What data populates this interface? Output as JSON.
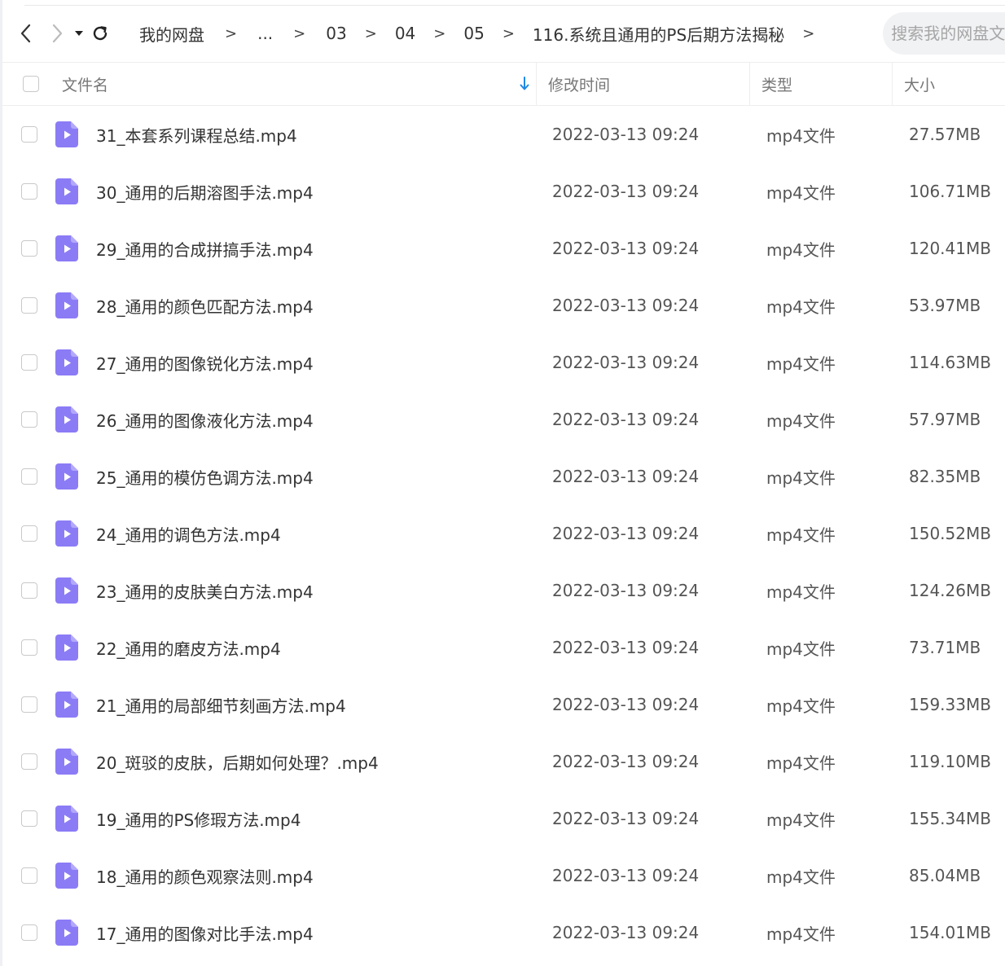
{
  "toolbar": {
    "breadcrumb": [
      "我的网盘",
      "...",
      "03",
      "04",
      "05",
      "116.系统且通用的PS后期方法揭秘"
    ],
    "breadcrumb_sep": ">",
    "search_placeholder": "搜索我的网盘文件"
  },
  "table": {
    "headers": {
      "name": "文件名",
      "time": "修改时间",
      "type": "类型",
      "size": "大小"
    },
    "rows": [
      {
        "name": "31_本套系列课程总结.mp4",
        "time": "2022-03-13 09:24",
        "type": "mp4文件",
        "size": "27.57MB"
      },
      {
        "name": "30_通用的后期溶图手法.mp4",
        "time": "2022-03-13 09:24",
        "type": "mp4文件",
        "size": "106.71MB"
      },
      {
        "name": "29_通用的合成拼搞手法.mp4",
        "time": "2022-03-13 09:24",
        "type": "mp4文件",
        "size": "120.41MB"
      },
      {
        "name": "28_通用的颜色匹配方法.mp4",
        "time": "2022-03-13 09:24",
        "type": "mp4文件",
        "size": "53.97MB"
      },
      {
        "name": "27_通用的图像锐化方法.mp4",
        "time": "2022-03-13 09:24",
        "type": "mp4文件",
        "size": "114.63MB"
      },
      {
        "name": "26_通用的图像液化方法.mp4",
        "time": "2022-03-13 09:24",
        "type": "mp4文件",
        "size": "57.97MB"
      },
      {
        "name": "25_通用的模仿色调方法.mp4",
        "time": "2022-03-13 09:24",
        "type": "mp4文件",
        "size": "82.35MB"
      },
      {
        "name": "24_通用的调色方法.mp4",
        "time": "2022-03-13 09:24",
        "type": "mp4文件",
        "size": "150.52MB"
      },
      {
        "name": "23_通用的皮肤美白方法.mp4",
        "time": "2022-03-13 09:24",
        "type": "mp4文件",
        "size": "124.26MB"
      },
      {
        "name": "22_通用的磨皮方法.mp4",
        "time": "2022-03-13 09:24",
        "type": "mp4文件",
        "size": "73.71MB"
      },
      {
        "name": "21_通用的局部细节刻画方法.mp4",
        "time": "2022-03-13 09:24",
        "type": "mp4文件",
        "size": "159.33MB"
      },
      {
        "name": "20_斑驳的皮肤，后期如何处理？.mp4",
        "time": "2022-03-13 09:24",
        "type": "mp4文件",
        "size": "119.10MB"
      },
      {
        "name": "19_通用的PS修瑕方法.mp4",
        "time": "2022-03-13 09:24",
        "type": "mp4文件",
        "size": "155.34MB"
      },
      {
        "name": "18_通用的颜色观察法则.mp4",
        "time": "2022-03-13 09:24",
        "type": "mp4文件",
        "size": "85.04MB"
      },
      {
        "name": "17_通用的图像对比手法.mp4",
        "time": "2022-03-13 09:24",
        "type": "mp4文件",
        "size": "154.01MB"
      }
    ]
  },
  "colors": {
    "video_icon": "#8b7cf6",
    "sort_arrow": "#1e88e5"
  }
}
